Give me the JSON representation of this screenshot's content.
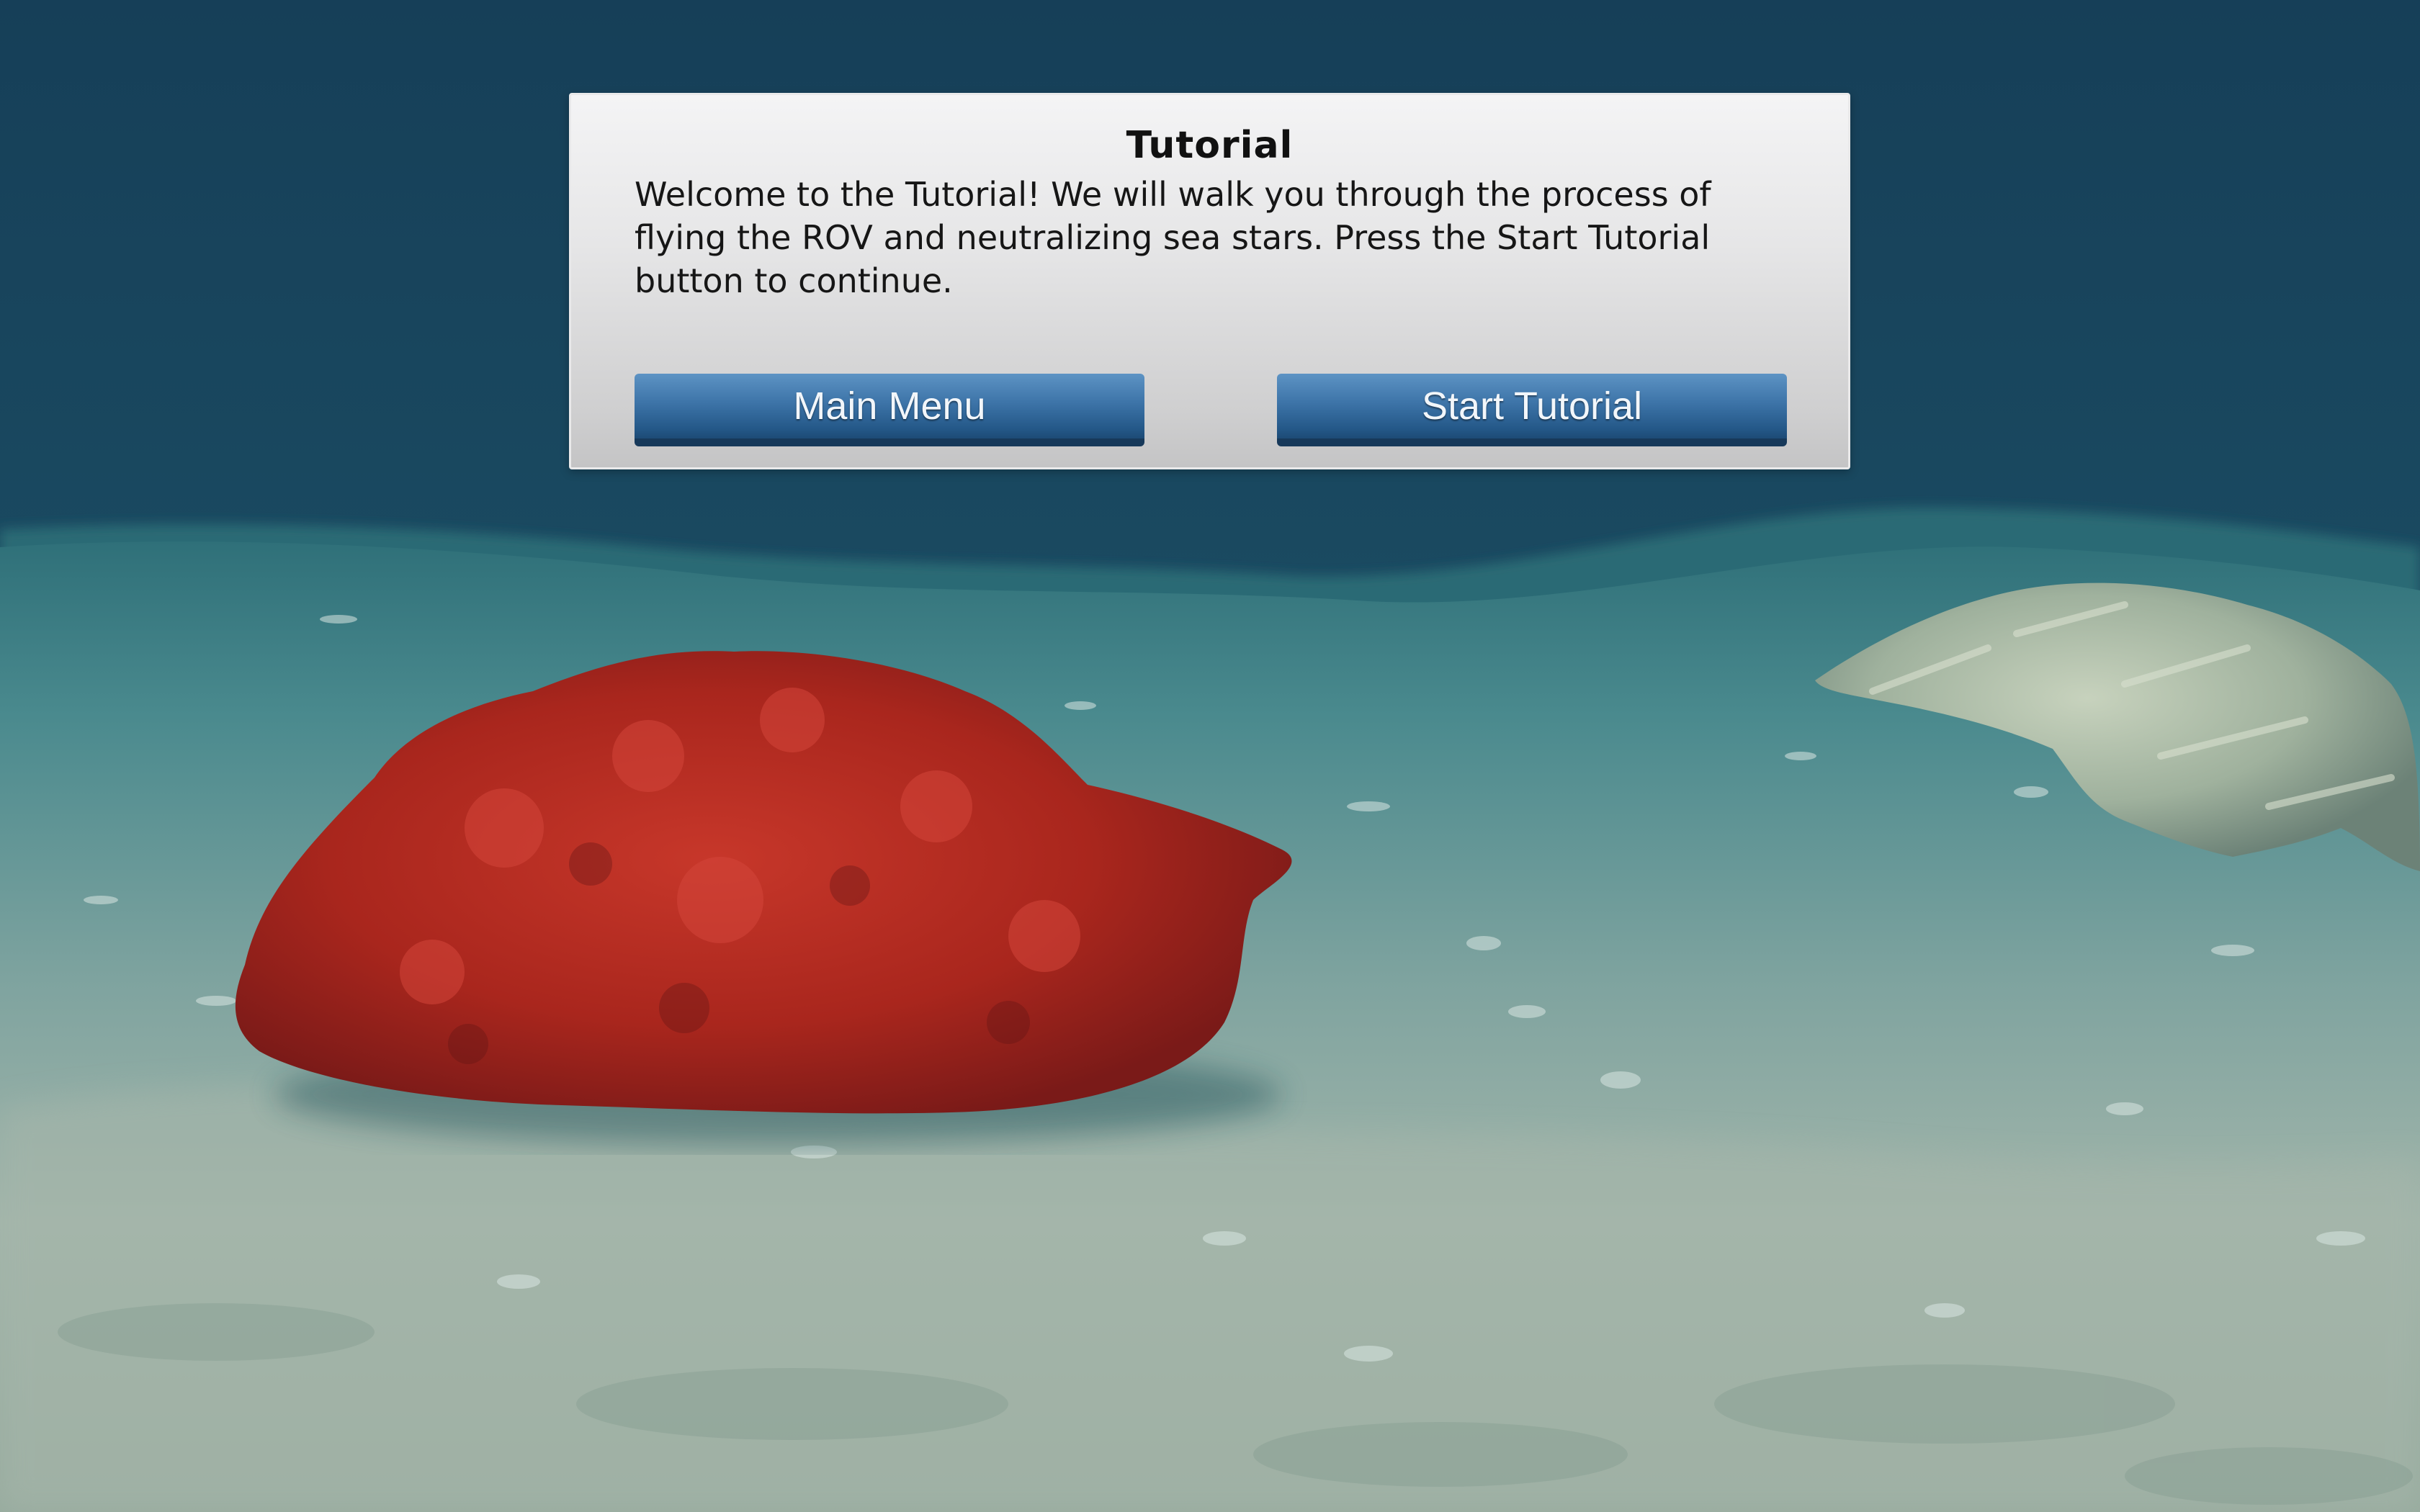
{
  "dialog": {
    "title": "Tutorial",
    "body": "Welcome to the Tutorial! We will walk you through the process of flying the ROV and neutralizing sea stars. Press the Start Tutorial button to continue.",
    "main_menu_label": "Main Menu",
    "start_tutorial_label": "Start Tutorial"
  },
  "colors": {
    "water_top": "#17415b",
    "water_mid": "#225d70",
    "seafloor_far": "#3f7f86",
    "seafloor_near": "#9fb3a8",
    "red_coral": "#b3281f",
    "pale_coral": "#a8b8a6",
    "button_blue": "#3d74a8"
  }
}
